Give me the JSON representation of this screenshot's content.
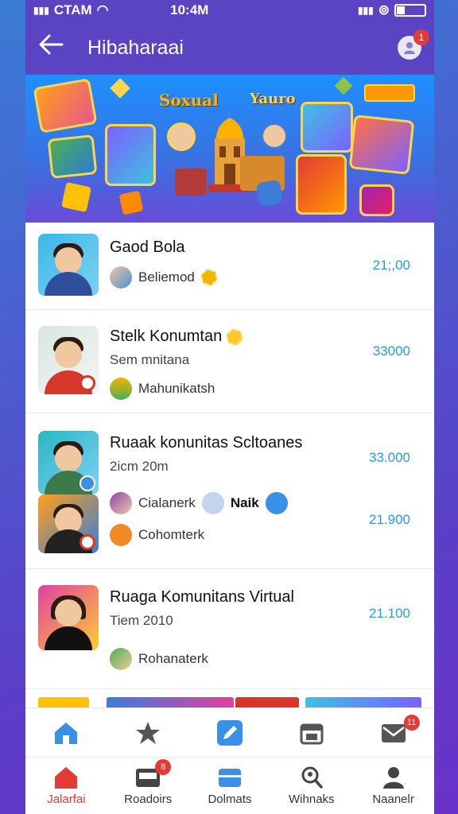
{
  "status": {
    "carrier": "CTAM",
    "time": "10:4M"
  },
  "header": {
    "title": "Hibaharaai",
    "notification_count": "1"
  },
  "banner": {
    "text_left": "Soxual",
    "text_right": "Yauro"
  },
  "items": [
    {
      "name": "Gaod Bola",
      "sub": "",
      "meta": "Beliemod",
      "value": "21;,00"
    },
    {
      "name": "Stelk Konumtan",
      "sub": "Sem mnitana",
      "meta": "Mahunikatsh",
      "value": "33000"
    },
    {
      "name": "Ruaak konunitas Scltoanes",
      "sub": "2icm 20m",
      "meta": "Cialanerk",
      "meta_extra": "Naik",
      "meta2": "Cohomterk",
      "value": "33.000",
      "value2": "21.900"
    },
    {
      "name": "Ruaga Komunitans Virtual",
      "sub": "Tiem 2010",
      "meta": "Rohanaterk",
      "value": "21.100"
    }
  ],
  "bottom_nav_top": {
    "last_badge": "11"
  },
  "bottom_nav": [
    {
      "label": "Jalarfai",
      "icon": "home-red-icon"
    },
    {
      "label": "Roadoirs",
      "icon": "inbox-icon",
      "badge": "8"
    },
    {
      "label": "Dolmats",
      "icon": "wallet-icon"
    },
    {
      "label": "Wihnaks",
      "icon": "search-user-icon"
    },
    {
      "label": "Naanelr",
      "icon": "profile-icon"
    }
  ],
  "colors": {
    "header": "#5a44c4",
    "value": "#2a9bd0",
    "accent_red": "#e53935",
    "nav_blue": "#3a8fe8"
  }
}
